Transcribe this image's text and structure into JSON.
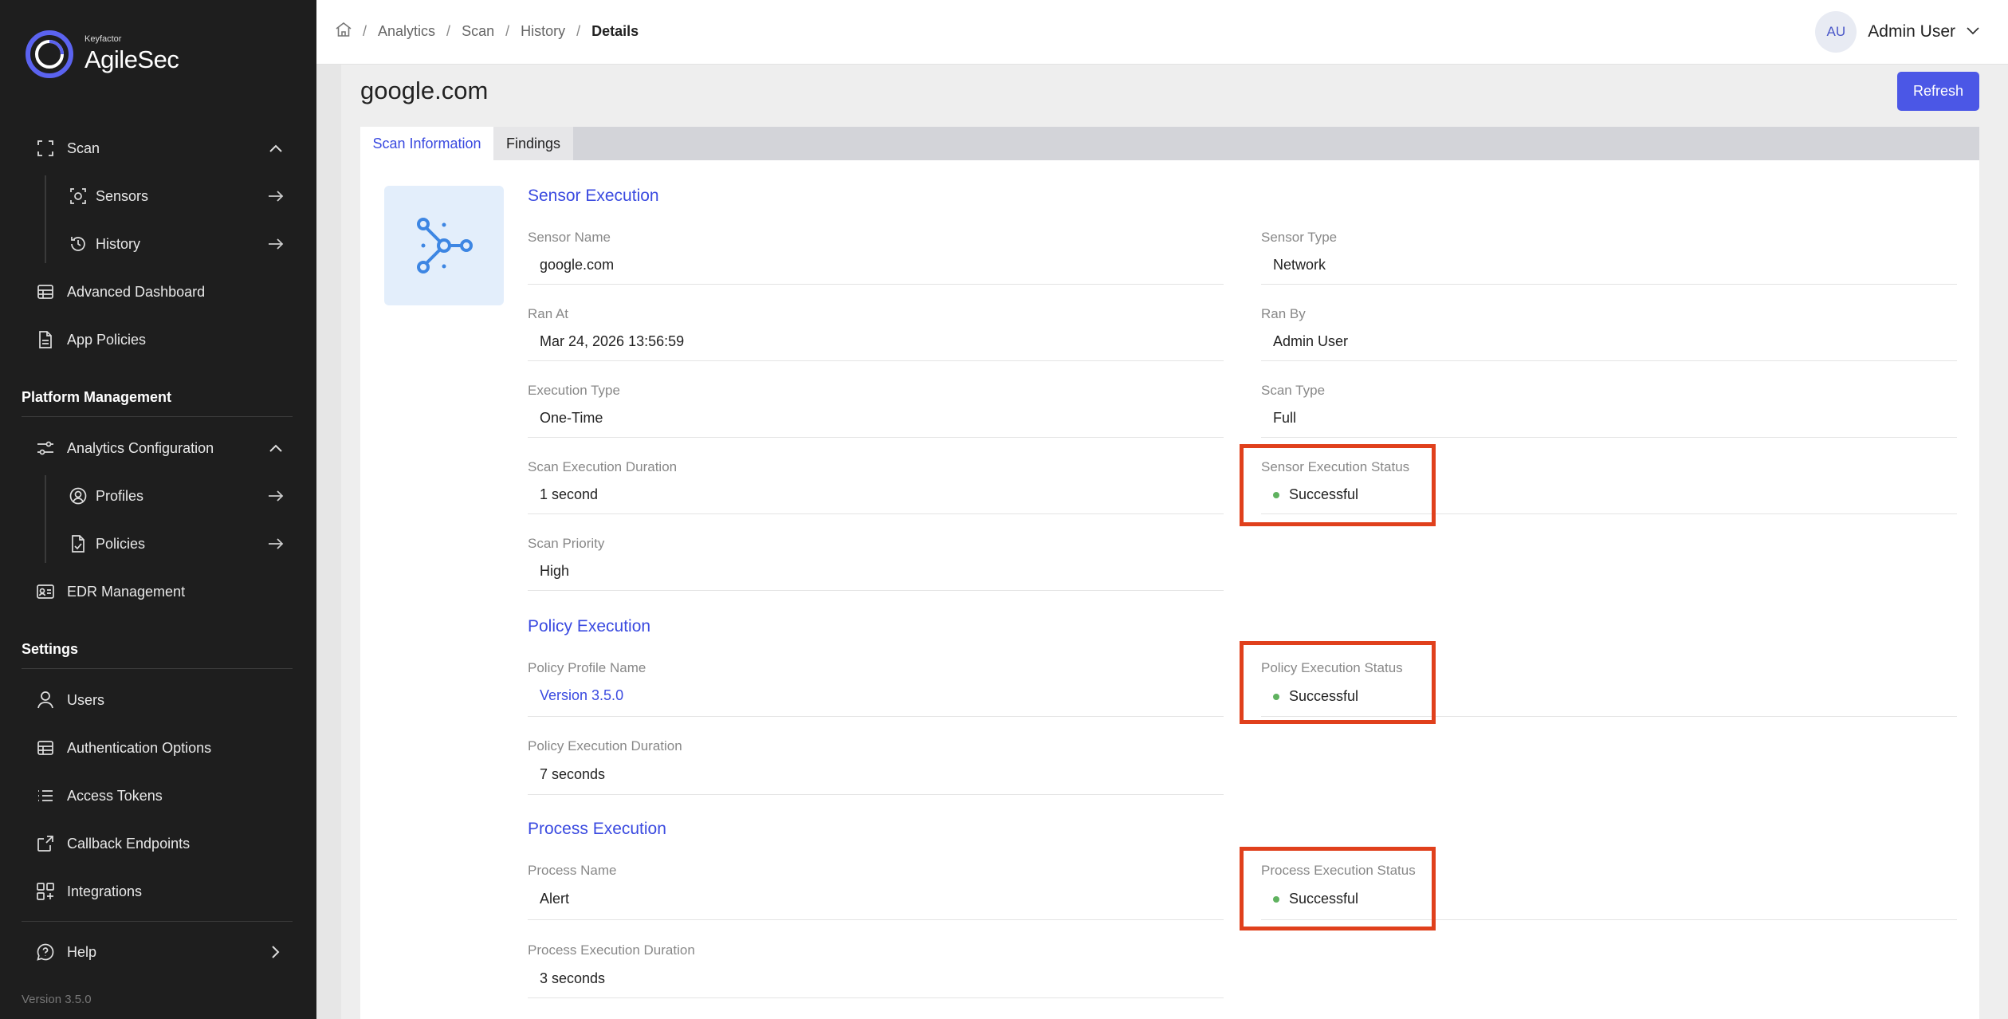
{
  "brand": {
    "sub": "Keyfactor",
    "name": "AgileSec"
  },
  "sidebar": {
    "scan": "Scan",
    "sensors": "Sensors",
    "history": "History",
    "advanced_dashboard": "Advanced Dashboard",
    "app_policies": "App Policies",
    "platform_management": "Platform Management",
    "analytics_configuration": "Analytics Configuration",
    "profiles": "Profiles",
    "policies": "Policies",
    "edr_management": "EDR Management",
    "settings": "Settings",
    "users": "Users",
    "authentication_options": "Authentication Options",
    "access_tokens": "Access Tokens",
    "callback_endpoints": "Callback Endpoints",
    "integrations": "Integrations",
    "help": "Help",
    "version": "Version 3.5.0"
  },
  "breadcrumb": {
    "analytics": "Analytics",
    "scan": "Scan",
    "history": "History",
    "details": "Details",
    "sep": "/"
  },
  "user": {
    "initials": "AU",
    "name": "Admin User"
  },
  "page": {
    "title": "google.com",
    "refresh_label": "Refresh"
  },
  "tabs": {
    "scan_information": "Scan Information",
    "findings": "Findings"
  },
  "sensor_execution": {
    "heading": "Sensor Execution",
    "sensor_name_label": "Sensor Name",
    "sensor_name": "google.com",
    "sensor_type_label": "Sensor Type",
    "sensor_type": "Network",
    "ran_at_label": "Ran At",
    "ran_at": "Mar 24, 2026 13:56:59",
    "ran_by_label": "Ran By",
    "ran_by": "Admin User",
    "execution_type_label": "Execution Type",
    "execution_type": "One-Time",
    "scan_type_label": "Scan Type",
    "scan_type": "Full",
    "duration_label": "Scan Execution Duration",
    "duration": "1 second",
    "status_label": "Sensor Execution Status",
    "status": "Successful",
    "priority_label": "Scan Priority",
    "priority": "High"
  },
  "policy_execution": {
    "heading": "Policy Execution",
    "profile_label": "Policy Profile Name",
    "profile": "Version 3.5.0",
    "status_label": "Policy Execution Status",
    "status": "Successful",
    "duration_label": "Policy Execution Duration",
    "duration": "7 seconds"
  },
  "process_execution": {
    "heading": "Process Execution",
    "name_label": "Process Name",
    "name": "Alert",
    "status_label": "Process Execution Status",
    "status": "Successful",
    "duration_label": "Process Execution Duration",
    "duration": "3 seconds"
  },
  "colors": {
    "accent": "#4b57e6",
    "success": "#5fb25f",
    "highlight": "#e0401c",
    "sidebar": "#1e1e1e"
  }
}
